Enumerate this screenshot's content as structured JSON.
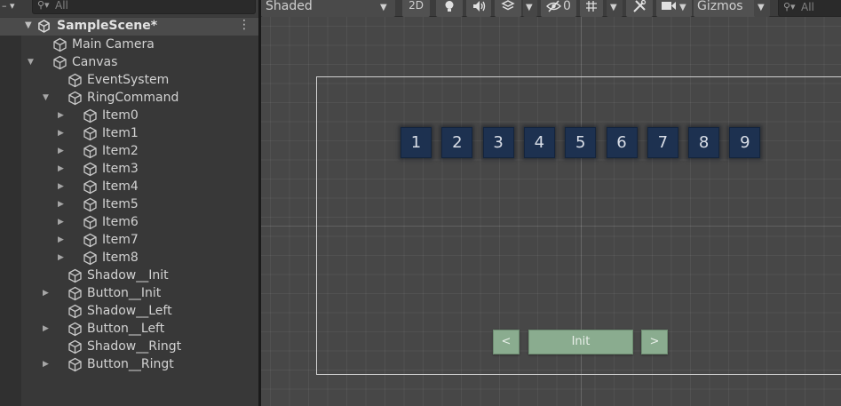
{
  "hierarchy": {
    "create_label": "– ▾",
    "search_placeholder": "All",
    "scene_name": "SampleScene*",
    "items": [
      {
        "label": "Main Camera"
      },
      {
        "label": "Canvas"
      },
      {
        "label": "EventSystem"
      },
      {
        "label": "RingCommand"
      },
      {
        "label": "Item0"
      },
      {
        "label": "Item1"
      },
      {
        "label": "Item2"
      },
      {
        "label": "Item3"
      },
      {
        "label": "Item4"
      },
      {
        "label": "Item5"
      },
      {
        "label": "Item6"
      },
      {
        "label": "Item7"
      },
      {
        "label": "Item8"
      },
      {
        "label": "Shadow__Init"
      },
      {
        "label": "Button__Init"
      },
      {
        "label": "Shadow__Left"
      },
      {
        "label": "Button__Left"
      },
      {
        "label": "Shadow__Ringt"
      },
      {
        "label": "Button__Ringt"
      }
    ]
  },
  "scene_toolbar": {
    "shading_mode": "Shaded",
    "mode_2d": "2D",
    "hidden_count": "0",
    "gizmos": "Gizmos",
    "search_placeholder": "All"
  },
  "scene": {
    "number_buttons": [
      "1",
      "2",
      "3",
      "4",
      "5",
      "6",
      "7",
      "8",
      "9"
    ],
    "nav_buttons": {
      "left": "<",
      "init": "Init",
      "right": ">"
    }
  },
  "colors": {
    "number_button_bg": "#1d3150",
    "nav_button_bg": "#8aac8f",
    "scene_bg": "#474747",
    "panel_bg": "#383838",
    "selected_row": "#4b4b4b"
  }
}
